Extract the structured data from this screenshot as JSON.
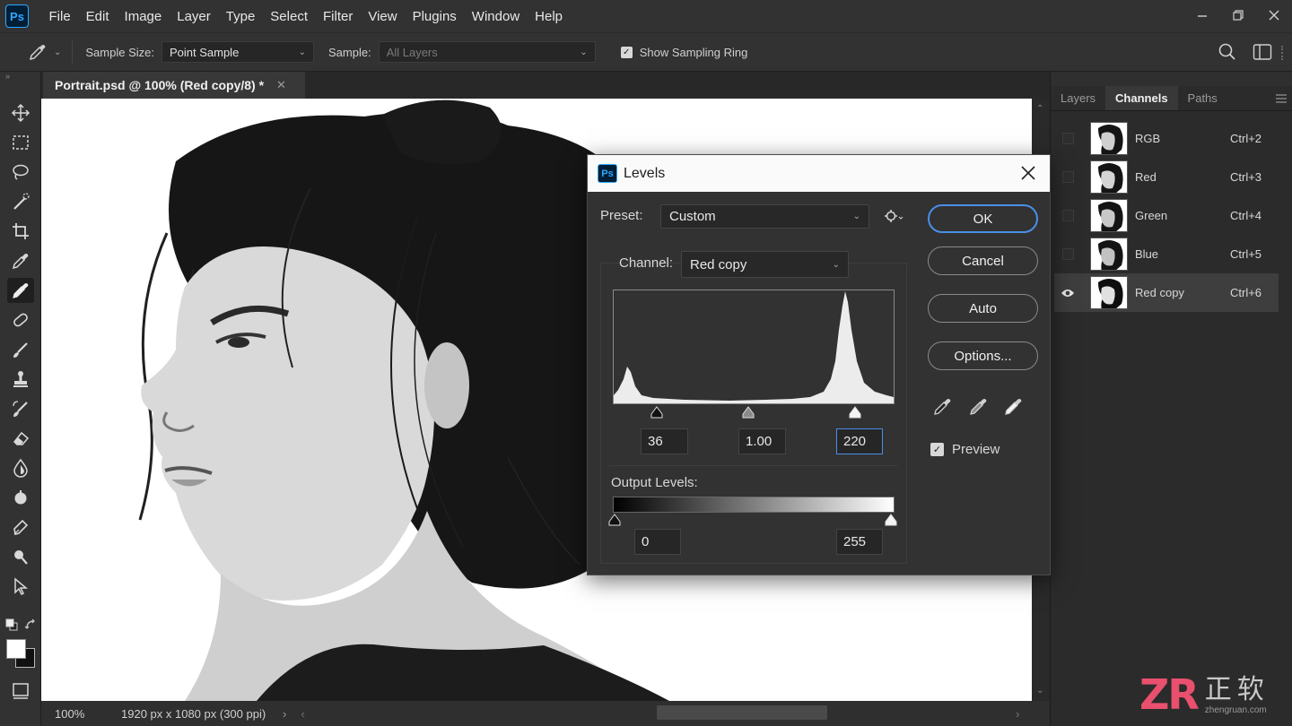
{
  "menubar": {
    "items": [
      "File",
      "Edit",
      "Image",
      "Layer",
      "Type",
      "Select",
      "Filter",
      "View",
      "Plugins",
      "Window",
      "Help"
    ]
  },
  "app": {
    "logo": "Ps"
  },
  "options": {
    "sample_size_label": "Sample Size:",
    "sample_size_value": "Point Sample",
    "sample_label": "Sample:",
    "sample_value": "All Layers",
    "show_ring_label": "Show Sampling Ring",
    "show_ring_checked": true
  },
  "document": {
    "tab_title": "Portrait.psd @ 100% (Red copy/8) *",
    "zoom": "100%",
    "info": "1920 px x 1080 px (300 ppi)"
  },
  "panel": {
    "tabs": [
      "Layers",
      "Channels",
      "Paths"
    ],
    "active_tab": "Channels",
    "channels": [
      {
        "name": "RGB",
        "shortcut": "Ctrl+2",
        "visible": false
      },
      {
        "name": "Red",
        "shortcut": "Ctrl+3",
        "visible": false
      },
      {
        "name": "Green",
        "shortcut": "Ctrl+4",
        "visible": false
      },
      {
        "name": "Blue",
        "shortcut": "Ctrl+5",
        "visible": false
      },
      {
        "name": "Red copy",
        "shortcut": "Ctrl+6",
        "visible": true
      }
    ]
  },
  "levels": {
    "title": "Levels",
    "preset_label": "Preset:",
    "preset_value": "Custom",
    "channel_label": "Channel:",
    "channel_value": "Red copy",
    "input_black": "36",
    "input_gamma": "1.00",
    "input_white": "220",
    "output_label": "Output Levels:",
    "output_black": "0",
    "output_white": "255",
    "buttons": {
      "ok": "OK",
      "cancel": "Cancel",
      "auto": "Auto",
      "options": "Options..."
    },
    "preview_label": "Preview",
    "preview_checked": true
  },
  "watermark": {
    "brand": "ZR",
    "cn": "正软",
    "url": "zhengruan.com"
  },
  "colors": {
    "accent": "#4a8fe8",
    "ps_blue": "#31a8ff",
    "ps_dark": "#001e36",
    "watermark_pink": "#e8506e"
  }
}
